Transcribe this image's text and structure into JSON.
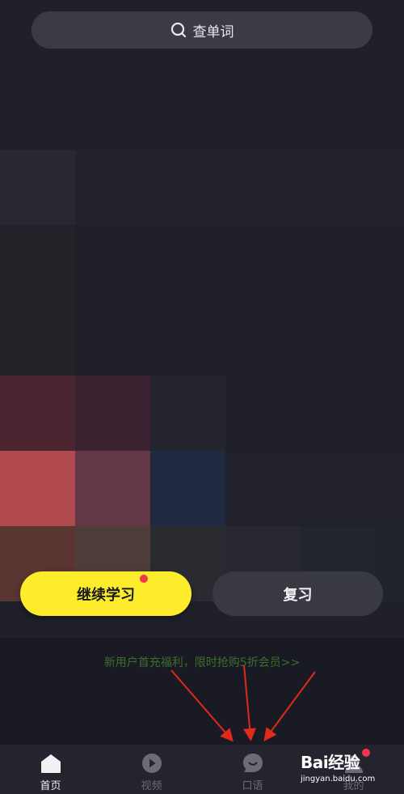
{
  "search": {
    "placeholder_text": "查单词",
    "icon": "search-icon"
  },
  "mosaic_tiles": [
    {
      "color": "#272830"
    },
    {
      "color": "#21222a"
    },
    {
      "color": "#21222a"
    },
    {
      "color": "#21222a"
    },
    {
      "color": "#21222a"
    },
    {
      "color": "#21222a"
    },
    {
      "color": "#222329"
    },
    {
      "color": "#1f2028"
    },
    {
      "color": "#1f2028"
    },
    {
      "color": "#1f2028"
    },
    {
      "color": "#1f2028"
    },
    {
      "color": "#1f2028"
    },
    {
      "color": "#222329"
    },
    {
      "color": "#1f2028"
    },
    {
      "color": "#1f2028"
    },
    {
      "color": "#1f2028"
    },
    {
      "color": "#1f2028"
    },
    {
      "color": "#1f2028"
    },
    {
      "color": "#4a2530"
    },
    {
      "color": "#3a2230"
    },
    {
      "color": "#23242c"
    },
    {
      "color": "#1f2028"
    },
    {
      "color": "#1f2028"
    },
    {
      "color": "#1f2028"
    },
    {
      "color": "#b04a4e"
    },
    {
      "color": "#643747"
    },
    {
      "color": "#1f2a40"
    },
    {
      "color": "#20212a"
    },
    {
      "color": "#20212a"
    },
    {
      "color": "#20212a"
    },
    {
      "color": "#5a3532"
    },
    {
      "color": "#4e3d38"
    },
    {
      "color": "#2a2b30"
    },
    {
      "color": "#26272f"
    },
    {
      "color": "#23252c"
    },
    {
      "color": "#21232a"
    }
  ],
  "actions": {
    "continue_label": "继续学习",
    "review_label": "复习",
    "accent_color": "#fcec2c",
    "badge_color": "#f2344e"
  },
  "promo": {
    "text": "新用户首充福利，限时抢购5折会员>>"
  },
  "tabs": [
    {
      "label": "首页",
      "icon": "home-icon",
      "active": true
    },
    {
      "label": "视频",
      "icon": "play-icon",
      "active": false
    },
    {
      "label": "口语",
      "icon": "chat-bubble-icon",
      "active": false
    },
    {
      "label": "我的",
      "icon": "profile-icon",
      "active": false
    }
  ],
  "watermark": {
    "logo_text": "Bai经验",
    "url_text": "jingyan.baidu.com"
  }
}
